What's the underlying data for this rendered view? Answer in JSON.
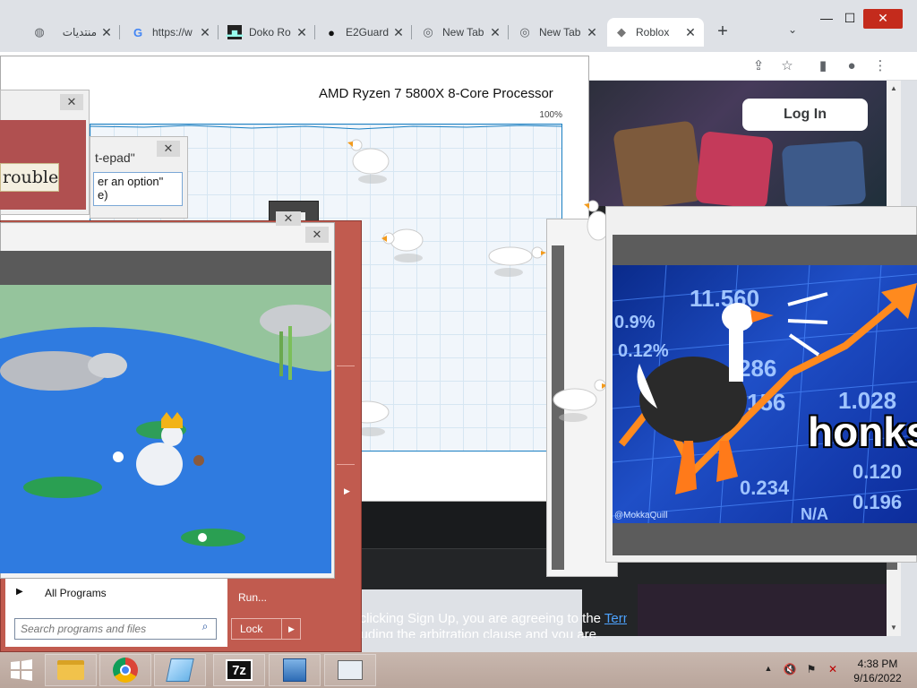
{
  "browser": {
    "tabs": [
      {
        "label": "منتديات",
        "icon": "globe-icon"
      },
      {
        "label": "https://w",
        "icon": "google-icon"
      },
      {
        "label": "Doko Ro",
        "icon": "doko-icon"
      },
      {
        "label": "E2Guard",
        "icon": "github-icon"
      },
      {
        "label": "New Tab",
        "icon": "chrome-icon"
      },
      {
        "label": "New Tab",
        "icon": "chrome-icon"
      },
      {
        "label": "Roblox",
        "icon": "roblox-icon"
      }
    ],
    "new_tab": "+",
    "tab_search": "⌄",
    "window_controls": {
      "minimize": "—",
      "maximize": "☐",
      "close": "✕"
    }
  },
  "roblox": {
    "login_label": "Log In",
    "terms_prefix": "By clicking Sign Up, you are agreeing to the ",
    "terms_link": "Terms of",
    "terms_line2": "including the arbitration clause and you are"
  },
  "task_manager": {
    "cpu_name": "AMD Ryzen 7 5800X 8-Core Processor",
    "utilization_max": "100%"
  },
  "dialogs": {
    "trouble_text": "rouble",
    "note_text": "t-epad\"",
    "note_box_line1": "er an option\"",
    "note_box_line2": "e)"
  },
  "start_menu": {
    "all_programs": "All Programs",
    "search_placeholder": "Search programs and files",
    "run": "Run...",
    "lock": "Lock"
  },
  "honk_meme": {
    "caption": "honks",
    "credit": "@MokkaQuill",
    "tickers": [
      "11.560",
      "0.9%",
      "0.12%",
      "286",
      "156",
      "1.028",
      "0.234",
      "0.196",
      "N/A",
      "0.120"
    ]
  },
  "taskbar": {
    "time": "4:38 PM",
    "date": "9/16/2022",
    "apps": [
      "explorer-icon",
      "chrome-icon",
      "notepad-icon",
      "7zip-icon",
      "network-icon",
      "taskmgr-icon"
    ]
  }
}
